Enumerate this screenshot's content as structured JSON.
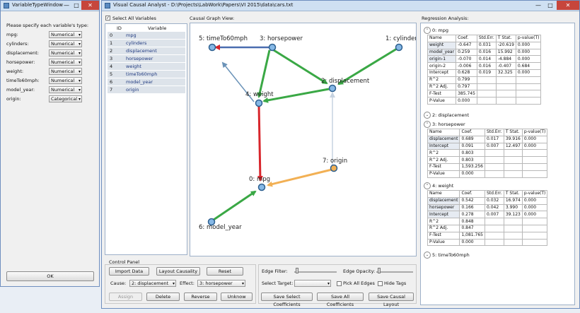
{
  "var_window": {
    "title": "VariableTypeWindow",
    "prompt": "Please specify each variable's type:",
    "rows": [
      {
        "name": "mpg:",
        "type": "Numerical"
      },
      {
        "name": "cylinders:",
        "type": "Numerical"
      },
      {
        "name": "displacement:",
        "type": "Numerical"
      },
      {
        "name": "horsepower:",
        "type": "Numerical"
      },
      {
        "name": "weight:",
        "type": "Numerical"
      },
      {
        "name": "timeTo60mph:",
        "type": "Numerical"
      },
      {
        "name": "model_year:",
        "type": "Numerical"
      },
      {
        "name": "origin:",
        "type": "Categorical"
      }
    ],
    "ok_label": "OK"
  },
  "main_window": {
    "title": "Visual Causal Analyst - D:\\Projects\\LabWork\\Papers\\VI 2015\\data\\cars.txt",
    "min_symbol": "—",
    "max_symbol": "□",
    "close_symbol": "✕"
  },
  "var_panel": {
    "select_all": "Select All Variables",
    "col_id": "ID",
    "col_var": "Variable",
    "rows": [
      {
        "id": "0",
        "name": "mpg"
      },
      {
        "id": "1",
        "name": "cylinders"
      },
      {
        "id": "2",
        "name": "displacement"
      },
      {
        "id": "3",
        "name": "horsepower"
      },
      {
        "id": "4",
        "name": "weight"
      },
      {
        "id": "5",
        "name": "timeTo60mph"
      },
      {
        "id": "6",
        "name": "model_year"
      },
      {
        "id": "7",
        "name": "origin"
      }
    ]
  },
  "graph": {
    "label": "Causal Graph View:",
    "nodes": {
      "timeTo60mph": "5: timeTo60mph",
      "horsepower": "3: horsepower",
      "cylinders": "1: cylinders",
      "displacement": "2: displacement",
      "weight": "4: weight",
      "origin": "7: origin",
      "mpg": "0: mpg",
      "model_year": "6: model_year"
    },
    "colors": {
      "green": "#3aa845",
      "red": "#d8262c",
      "orange": "#f2b054",
      "steel": "#6b93b8",
      "light": "#c7d3e0",
      "node_fill": "#86b8e6",
      "node_stroke": "#2d5f8f"
    }
  },
  "control": {
    "title": "Control Panel",
    "import": "Import Data",
    "layout": "Layout Causality",
    "reset": "Reset",
    "cause_label": "Cause:",
    "cause_value": "2: displacement",
    "effect_label": "Effect:",
    "effect_value": "3: horsepower",
    "assign": "Assign",
    "delete": "Delete",
    "reverse": "Reverse",
    "unknow": "Unknow",
    "edge_filter": "Edge Filter:",
    "edge_opacity": "Edge Opacity:",
    "select_target": "Select Target:",
    "pick_all": "Pick All Edges",
    "hide_tags": "Hide Tags",
    "save_select": "Save Select Coefficients",
    "save_all": "Save All Coefficients",
    "save_layout": "Save Causal Layout"
  },
  "regression": {
    "label": "Regression Analysis:",
    "sections": {
      "mpg": "0: mpg",
      "displacement": "2: displacement",
      "horsepower": "3: horsepower",
      "weight": "4: weight",
      "timeTo60mph": "5: timeTo60mph"
    },
    "headers": [
      "Name",
      "Coef.",
      "Std.Err.",
      "T Stat.",
      "p-value(T)"
    ],
    "mpg_rows": [
      [
        "weight",
        "-0.647",
        "0.031",
        "-20.619",
        "0.000"
      ],
      [
        "model_year",
        "0.259",
        "0.016",
        "15.992",
        "0.000"
      ],
      [
        "origin-1",
        "-0.070",
        "0.014",
        "-4.884",
        "0.000"
      ],
      [
        "origin-2",
        "-0.006",
        "0.016",
        "-0.407",
        "0.684"
      ],
      [
        "Intercept",
        "0.628",
        "0.019",
        "32.325",
        "0.000"
      ],
      [
        "R^2",
        "0.799",
        "",
        "",
        ""
      ],
      [
        "R^2 Adj.",
        "0.797",
        "",
        "",
        ""
      ],
      [
        "F-Test",
        "385.745",
        "",
        "",
        ""
      ],
      [
        "P-Value",
        "0.000",
        "",
        "",
        ""
      ]
    ],
    "hp_rows": [
      [
        "displacement",
        "0.689",
        "0.017",
        "39.916",
        "0.000"
      ],
      [
        "Intercept",
        "0.091",
        "0.007",
        "12.497",
        "0.000"
      ],
      [
        "R^2",
        "0.803",
        "",
        "",
        ""
      ],
      [
        "R^2 Adj.",
        "0.803",
        "",
        "",
        ""
      ],
      [
        "F-Test",
        "1,593.256",
        "",
        "",
        ""
      ],
      [
        "P-Value",
        "0.000",
        "",
        "",
        ""
      ]
    ],
    "wt_rows": [
      [
        "displacement",
        "0.542",
        "0.032",
        "16.974",
        "0.000"
      ],
      [
        "horsepower",
        "0.166",
        "0.042",
        "3.990",
        "0.000"
      ],
      [
        "Intercept",
        "0.278",
        "0.007",
        "39.123",
        "0.000"
      ],
      [
        "R^2",
        "0.848",
        "",
        "",
        ""
      ],
      [
        "R^2 Adj.",
        "0.847",
        "",
        "",
        ""
      ],
      [
        "F-Test",
        "1,081.765",
        "",
        "",
        ""
      ],
      [
        "P-Value",
        "0.000",
        "",
        "",
        ""
      ]
    ]
  }
}
